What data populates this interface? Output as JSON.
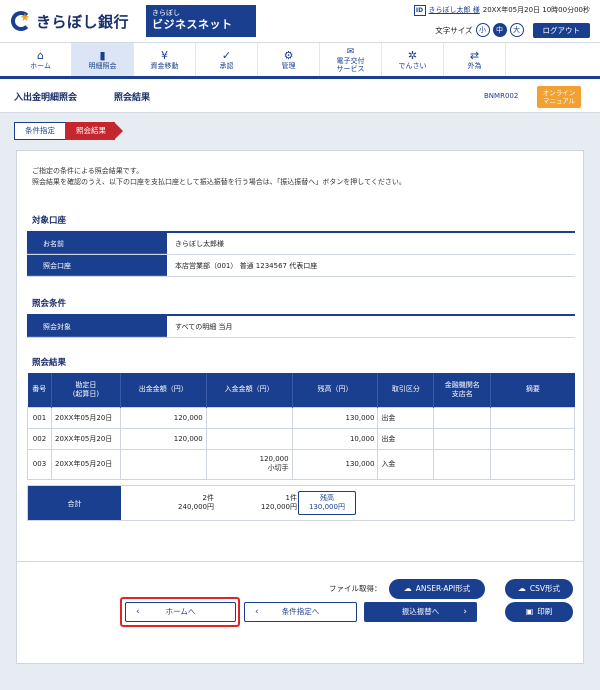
{
  "header": {
    "bank_name": "きらぼし銀行",
    "service_sub": "きらぼし",
    "service_main": "ビジネスネット",
    "user_icon": "ID",
    "user_name": "きらぼし太郎 様",
    "last_login": "20XX年05月20日 10時00分00秒",
    "font_size_label": "文字サイズ",
    "font_sizes": [
      "小",
      "中",
      "大"
    ],
    "logout_label": "ログアウト"
  },
  "nav": {
    "items": [
      {
        "label": "ホーム",
        "icon": "home-icon"
      },
      {
        "label": "明細照会",
        "icon": "document-icon",
        "active": true
      },
      {
        "label": "資金移動",
        "icon": "yen-icon"
      },
      {
        "label": "承認",
        "icon": "approval-icon"
      },
      {
        "label": "管理",
        "icon": "admin-icon"
      },
      {
        "label": "電子交付\nサービス",
        "icon": "mail-icon"
      },
      {
        "label": "でんさい",
        "icon": "densai-icon"
      },
      {
        "label": "外為",
        "icon": "forex-icon"
      }
    ]
  },
  "titlebar": {
    "title": "入出金明細照会",
    "subtitle": "照会結果",
    "screen_id": "BNMR002",
    "manual_label": "オンライン\nマニュアル"
  },
  "steps": [
    "条件指定",
    "照会結果"
  ],
  "intro": {
    "line1": "ご指定の条件による照会結果です。",
    "line2": "照会結果を確認のうえ、以下の口座を支払口座として振込振替を行う場合は、「振込振替へ」ボタンを押してください。"
  },
  "account": {
    "title": "対象口座",
    "rows": [
      {
        "key": "お名前",
        "value": "きらぼし太郎様"
      },
      {
        "key": "照会口座",
        "value": "本店営業部（001） 普通 1234567 代表口座"
      }
    ]
  },
  "conditions": {
    "title": "照会条件",
    "rows": [
      {
        "key": "照会対象",
        "value": "すべての明細 当月"
      }
    ]
  },
  "results": {
    "title": "照会結果",
    "headers": [
      "番号",
      "勘定日\n(起算日)",
      "出金金額（円）",
      "入金金額（円）",
      "残高（円）",
      "取引区分",
      "金融機関名\n支店名",
      "摘要"
    ],
    "rows": [
      {
        "no": "001",
        "date": "20XX年05月20日",
        "withdraw": "120,000",
        "deposit": "",
        "deposit_note": "",
        "balance": "130,000",
        "type": "出金",
        "bank": "",
        "memo": ""
      },
      {
        "no": "002",
        "date": "20XX年05月20日",
        "withdraw": "120,000",
        "deposit": "",
        "deposit_note": "",
        "balance": "10,000",
        "type": "出金",
        "bank": "",
        "memo": ""
      },
      {
        "no": "003",
        "date": "20XX年05月20日",
        "withdraw": "",
        "deposit": "120,000",
        "deposit_note": "小切手",
        "balance": "130,000",
        "type": "入金",
        "bank": "",
        "memo": ""
      }
    ],
    "totals": {
      "label": "合計",
      "withdraw_count": "2件",
      "withdraw_sum": "240,000円",
      "deposit_count": "1件",
      "deposit_sum": "120,000円",
      "balance_label": "残高",
      "balance_value": "130,000円"
    }
  },
  "footer": {
    "file_label": "ファイル取得：",
    "anser_label": "ANSER-API形式",
    "csv_label": "CSV形式",
    "home_label": "ホームへ",
    "cond_label": "条件指定へ",
    "transfer_label": "振込振替へ",
    "print_label": "印刷"
  },
  "colors": {
    "primary": "#1a3f8f",
    "accent_red": "#c4282e",
    "manual_orange": "#f2a030",
    "highlight": "#e0242a"
  }
}
